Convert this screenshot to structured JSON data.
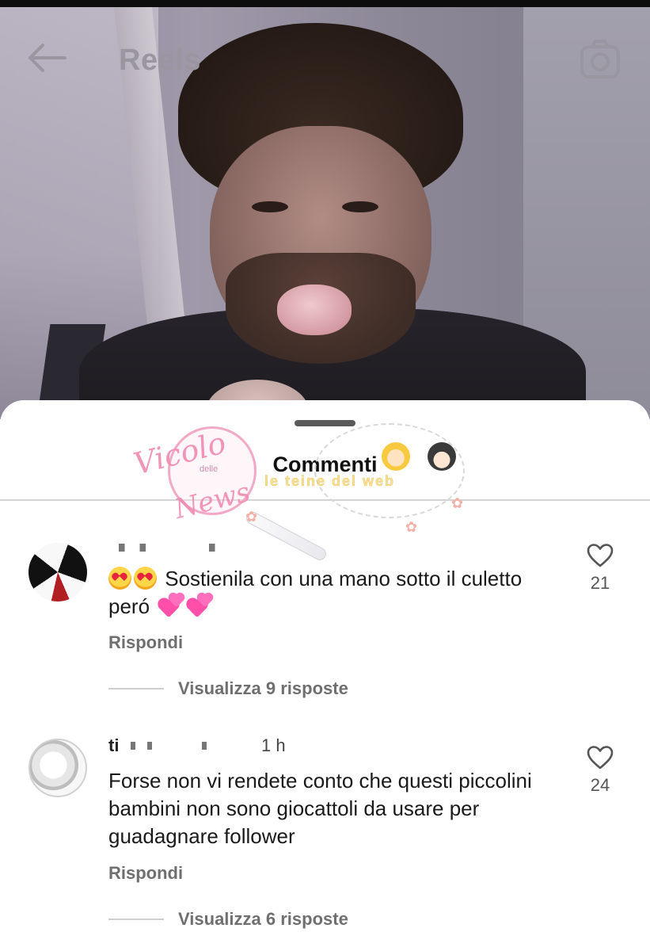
{
  "header": {
    "title": "Reels",
    "back_icon": "arrow-left-icon",
    "camera_icon": "camera-icon"
  },
  "sheet": {
    "title": "Commenti"
  },
  "watermark": {
    "line1": "Vicolo",
    "line_small": "delle",
    "line2": "News",
    "subtitle": "le teine del web"
  },
  "comments": [
    {
      "username": "",
      "time": "",
      "text": "Sostienila con una mano sotto il culetto peró",
      "reply_label": "Rispondi",
      "view_replies": "Visualizza 9 risposte",
      "likes": "21"
    },
    {
      "username": "ti",
      "time": "1 h",
      "text": "Forse non vi rendete conto che questi piccolini bambini non sono giocattoli da usare per guadagnare follower",
      "reply_label": "Rispondi",
      "view_replies": "Visualizza 6 risposte",
      "likes": "24"
    }
  ],
  "colors": {
    "heart_outline": "#555555",
    "muted_text": "#6f6f6f",
    "watermark_pink": "#f08ab0"
  }
}
